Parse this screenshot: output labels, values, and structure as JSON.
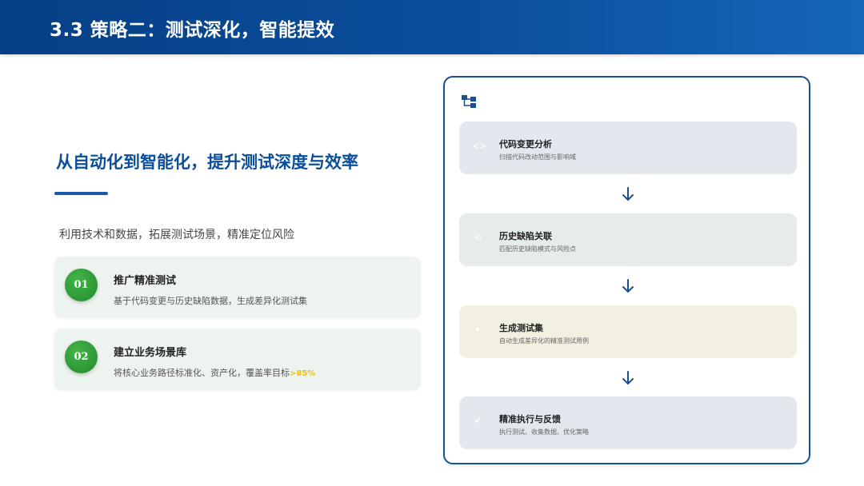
{
  "header": {
    "title": "3.3 策略二：测试深化，智能提效"
  },
  "main": {
    "subtitle": "从自动化到智能化，提升测试深度与效率",
    "intro": "利用技术和数据，拓展测试场景，精准定位风险",
    "cards": [
      {
        "num": "01",
        "title": "推广精准测试",
        "desc": "基于代码变更与历史缺陷数据，生成差异化测试集"
      },
      {
        "num": "02",
        "title": "建立业务场景库",
        "desc": "将核心业务路径标准化、资产化，覆盖率目标",
        "highlight": ">85%"
      }
    ]
  },
  "flow": {
    "icon": "flowchart-icon",
    "steps": [
      {
        "title": "代码变更分析",
        "desc": "扫描代码改动范围与影响域",
        "icon": "code-icon"
      },
      {
        "title": "历史缺陷关联",
        "desc": "匹配历史缺陷模式与风险点",
        "icon": "history-icon"
      },
      {
        "title": "生成测试集",
        "desc": "自动生成差异化的精准测试用例",
        "icon": "magic-icon"
      },
      {
        "title": "精准执行与反馈",
        "desc": "执行测试、收集数据、优化策略",
        "icon": "check-icon"
      }
    ]
  },
  "colors": {
    "header_bg": "#0b4f9c",
    "accent_blue": "#0b4f9c",
    "badge_green": "#2e9e3a",
    "highlight_yellow": "#f2c200"
  }
}
